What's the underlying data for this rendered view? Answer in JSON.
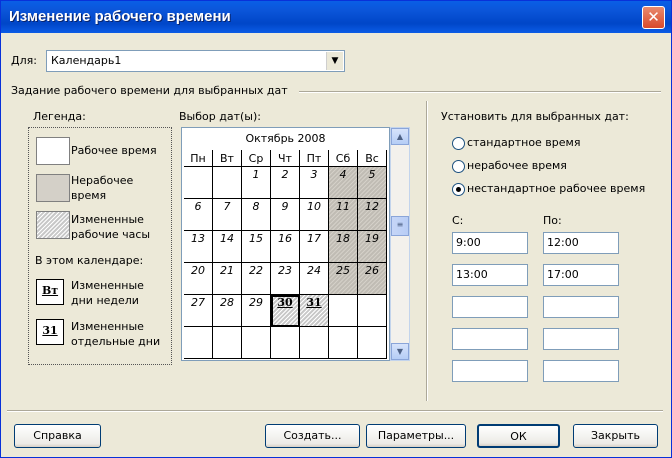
{
  "window": {
    "title": "Изменение рабочего времени"
  },
  "calendar_select": {
    "label": "Для:",
    "value": "Календарь1"
  },
  "section_title": "Задание рабочего времени для выбранных дат",
  "legend": {
    "title": "Легенда:",
    "items": [
      "Рабочее время",
      "Нерабочее время",
      "Измененные рабочие часы"
    ],
    "subtitle": "В этом календаре:",
    "cal_items": [
      {
        "icon_text": "Вт",
        "label": "Измененные дни недели"
      },
      {
        "icon_text": "31",
        "label": "Измененные отдельные дни"
      }
    ]
  },
  "date_picker": {
    "title": "Выбор дат(ы):",
    "month": "Октябрь 2008",
    "weekdays": [
      "Пн",
      "Вт",
      "Ср",
      "Чт",
      "Пт",
      "Сб",
      "Вс"
    ],
    "weeks": [
      [
        "",
        "",
        "1",
        "2",
        "3",
        "4",
        "5"
      ],
      [
        "6",
        "7",
        "8",
        "9",
        "10",
        "11",
        "12"
      ],
      [
        "13",
        "14",
        "15",
        "16",
        "17",
        "18",
        "19"
      ],
      [
        "20",
        "21",
        "22",
        "23",
        "24",
        "25",
        "26"
      ],
      [
        "27",
        "28",
        "29",
        "30",
        "31",
        "",
        ""
      ],
      [
        "",
        "",
        "",
        "",
        "",
        "",
        ""
      ]
    ],
    "selected_day": "30",
    "modified_days": [
      "30",
      "31"
    ]
  },
  "set_options": {
    "title": "Установить для выбранных дат:",
    "radios": [
      "стандартное время",
      "нерабочее время",
      "нестандартное рабочее время"
    ],
    "selected_index": 2,
    "from_label": "С:",
    "to_label": "По:",
    "intervals": [
      {
        "from": "9:00",
        "to": "12:00"
      },
      {
        "from": "13:00",
        "to": "17:00"
      },
      {
        "from": "",
        "to": ""
      },
      {
        "from": "",
        "to": ""
      },
      {
        "from": "",
        "to": ""
      }
    ]
  },
  "buttons": {
    "help": "Справка",
    "create": "Создать...",
    "params": "Параметры...",
    "ok": "ОК",
    "close": "Закрыть"
  },
  "colors": {
    "title_bar": "#0054e3",
    "face": "#ece9d8",
    "nonworking": "#d4d0c8"
  }
}
